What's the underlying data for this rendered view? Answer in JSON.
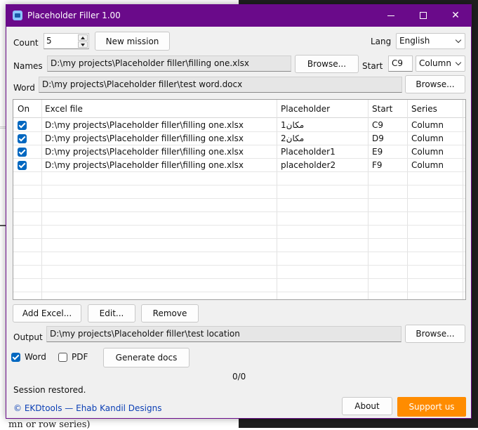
{
  "background": {
    "bottom_text": "mn or row series)"
  },
  "window": {
    "title": "Placeholder Filler 1.00",
    "title_color": "#6a0a8a"
  },
  "top": {
    "count_label": "Count",
    "count_value": "5",
    "new_mission_label": "New mission",
    "lang_label": "Lang",
    "lang_value": "English",
    "names_label": "Names",
    "names_path": "D:\\my projects\\Placeholder filler\\filling one.xlsx",
    "names_browse": "Browse...",
    "start_label": "Start",
    "start_value": "C9",
    "series_value": "Column",
    "word_label": "Word",
    "word_path": "D:\\my projects\\Placeholder filler\\test word.docx",
    "word_browse": "Browse..."
  },
  "table": {
    "columns": [
      "On",
      "Excel file",
      "Placeholder",
      "Start",
      "Series"
    ],
    "rows": [
      {
        "on": true,
        "file": "D:\\my projects\\Placeholder filler\\filling one.xlsx",
        "placeholder": "مكان1",
        "start": "C9",
        "series": "Column"
      },
      {
        "on": true,
        "file": "D:\\my projects\\Placeholder filler\\filling one.xlsx",
        "placeholder": "مكان2",
        "start": "D9",
        "series": "Column"
      },
      {
        "on": true,
        "file": "D:\\my projects\\Placeholder filler\\filling one.xlsx",
        "placeholder": "Placeholder1",
        "start": "E9",
        "series": "Column"
      },
      {
        "on": true,
        "file": "D:\\my projects\\Placeholder filler\\filling one.xlsx",
        "placeholder": "placeholder2",
        "start": "F9",
        "series": "Column"
      }
    ]
  },
  "actions": {
    "add_excel": "Add Excel...",
    "edit": "Edit...",
    "remove": "Remove"
  },
  "output": {
    "label": "Output",
    "path": "D:\\my projects\\Placeholder filler\\test location",
    "browse": "Browse..."
  },
  "options": {
    "word_label": "Word",
    "word_checked": true,
    "pdf_label": "PDF",
    "pdf_checked": false,
    "generate_label": "Generate docs"
  },
  "status": {
    "progress": "0/0",
    "message": "Session restored."
  },
  "footer": {
    "credit": "© EKDtools — Ehab Kandil Designs",
    "about": "About",
    "support": "Support us",
    "support_color": "#ff8c00"
  }
}
